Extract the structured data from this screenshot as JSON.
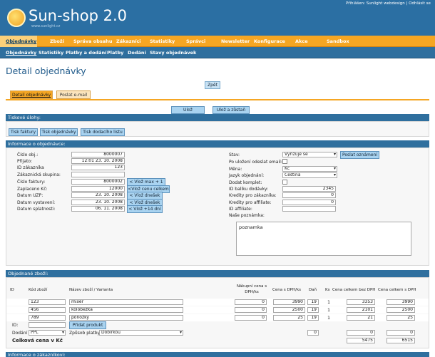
{
  "header": {
    "logo_text": "Sun-shop 2.0",
    "logo_sub": "www.sunlight.cz",
    "login_text": "Přihlášen: Sunlight webdesign",
    "logout_text": "Odhlásit se"
  },
  "mainnav": [
    "Objednávky",
    "Zboží",
    "Správa obsahu",
    "Zákazníci",
    "Statistiky",
    "Správci",
    "Newsletter",
    "Konfigurace",
    "Akce",
    "Sandbox"
  ],
  "subnav": [
    "Objednávky",
    "Statistiky",
    "Platby a dodání",
    "Platby",
    "Dodání",
    "Stavy objednávek"
  ],
  "page_title": "Detail objednávky",
  "back_button": "Zpět",
  "tabs": [
    "Detail objednávky",
    "Poslat e-mail"
  ],
  "save_button": "Ulož",
  "save_stay_button": "Ulož a zůstaň",
  "print_section": {
    "title": "Tiskové úlohy:",
    "buttons": [
      "Tisk faktury",
      "Tisk objednávky",
      "Tisk dodacího listu"
    ]
  },
  "info_section": {
    "title": "Informace o objednávce:",
    "left_labels": [
      "Číslo obj.:",
      "Přijato:",
      "ID zákazníka",
      "Zákaznická skupina:",
      "Číslo faktury:",
      "Zaplaceno Kč:",
      "Datum UZP:",
      "Datum vystavení:",
      "Datum splatnosti:"
    ],
    "left_values": [
      "8000007",
      "12:01 23. 10. 2008",
      "123",
      "",
      "8000002",
      "12000",
      "23. 10. 2008",
      "23. 10. 2008",
      "06. 11. 2008"
    ],
    "side_buttons": [
      "< Vlož max + 1",
      "<Vlož cenu celkem",
      "< Vlož dnešek",
      "< Vlož dnešek",
      "< Vlož +14 dní"
    ],
    "right_labels": [
      "Stav:",
      "Po uložení odeslat email:",
      "Měna:",
      "Jazyk objednání:",
      "Dodat komplet:",
      "ID balíku dodávky:",
      "Kredity pro zákazníka:",
      "Kredity pro affiliate:",
      "ID affiliate:",
      "Naše poznámka:"
    ],
    "status_value": "Vyřizuje se",
    "send_notice_button": "Poslat oznámení",
    "currency_value": "Kč",
    "language_value": "Čeština",
    "package_id": "2345",
    "customer_credits": "0",
    "affiliate_credits": "0",
    "affiliate_id": "",
    "note": "poznamka"
  },
  "goods_section": {
    "title": "Objednané zboží:",
    "headers": [
      "ID",
      "Kód zboží",
      "Název zboží / Varianta",
      "Nákupní cena s DPH/ks",
      "Cena s DPH/ks",
      "Daň",
      "Ks",
      "Cena celkem bez DPH",
      "Cena celkem s DPH"
    ],
    "rows": [
      {
        "code": "123",
        "name": "mixér",
        "purchase": "0",
        "price": "3990",
        "tax": "19",
        "qty": "1",
        "total_no_vat": "3353",
        "total_vat": "3990"
      },
      {
        "code": "456",
        "name": "koloběžka",
        "purchase": "0",
        "price": "2500",
        "tax": "19",
        "qty": "1",
        "total_no_vat": "2101",
        "total_vat": "2500"
      },
      {
        "code": "789",
        "name": "ponožky",
        "purchase": "0",
        "price": "25",
        "tax": "19",
        "qty": "1",
        "total_no_vat": "21",
        "total_vat": "25"
      }
    ],
    "id_label": "ID:",
    "add_product_button": "Přidat produkt",
    "delivery_label": "Dodání",
    "delivery_value": "PPL",
    "payment_label": "Způsob platby",
    "payment_value": "Dobírkou",
    "delivery_tax": "0",
    "delivery_total_no_vat": "0",
    "delivery_total_vat": "0",
    "total_label": "Celková cena v Kč",
    "total_no_vat": "5475",
    "total_vat": "6515"
  },
  "bottom_section_title": "Informace o zákazníkovi:"
}
